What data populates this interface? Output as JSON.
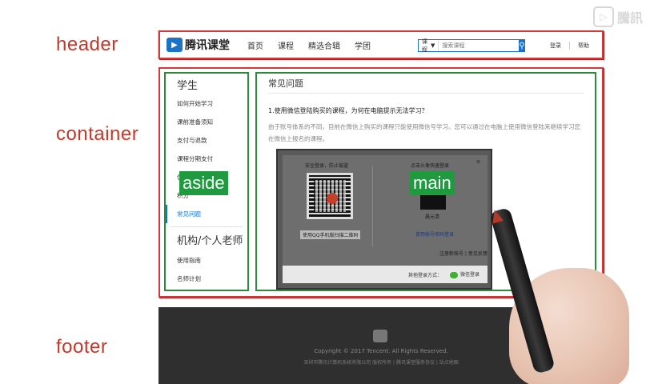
{
  "labels": {
    "header": "header",
    "container": "container",
    "aside": "aside",
    "main": "main",
    "footer": "footer"
  },
  "watermark": "騰訊",
  "header": {
    "logo_text": "腾讯课堂",
    "nav": [
      "首页",
      "课程",
      "精选合辑",
      "学团"
    ],
    "search_select": "课程",
    "search_placeholder": "搜索课程",
    "login": "登录",
    "help": "帮助"
  },
  "aside": {
    "group1_title": "学生",
    "group1_items": [
      "如何开始学习",
      "课前准备须知",
      "支付与退款",
      "课程分期支付",
      "优惠券",
      "积分",
      "常见问题"
    ],
    "group2_title": "机构/个人老师",
    "group2_items": [
      "使用指南",
      "名师计划"
    ]
  },
  "main": {
    "title": "常见问题",
    "question": "1.使用微信登陆购买的课程，为何在电脑提示无法学习？",
    "answer": "由于账号体系的不同，目前在微信上购买的课程只能使用微信号学习。您可以通过在电脑上使用微信登陆来继续学习您在微信上报名的课程。",
    "shot": {
      "left_title": "安全登录，防止被盗",
      "right_title": "点击头像快速登录",
      "left_button": "使用QQ手机版扫描二维码",
      "right_name": "晨元清",
      "right_link": "使用帐号密码登录",
      "mid_links": "注册新帐号 | 意见反馈",
      "other_login": "其他登录方式：",
      "wechat_login": "微信登录"
    }
  },
  "footer": {
    "copyright": "Copyright © 2017 Tencent. All Rights Reserved.",
    "links": "深圳市腾讯计算机系统有限公司 版权所有 | 腾讯课堂服务协议 | 站点地图"
  }
}
